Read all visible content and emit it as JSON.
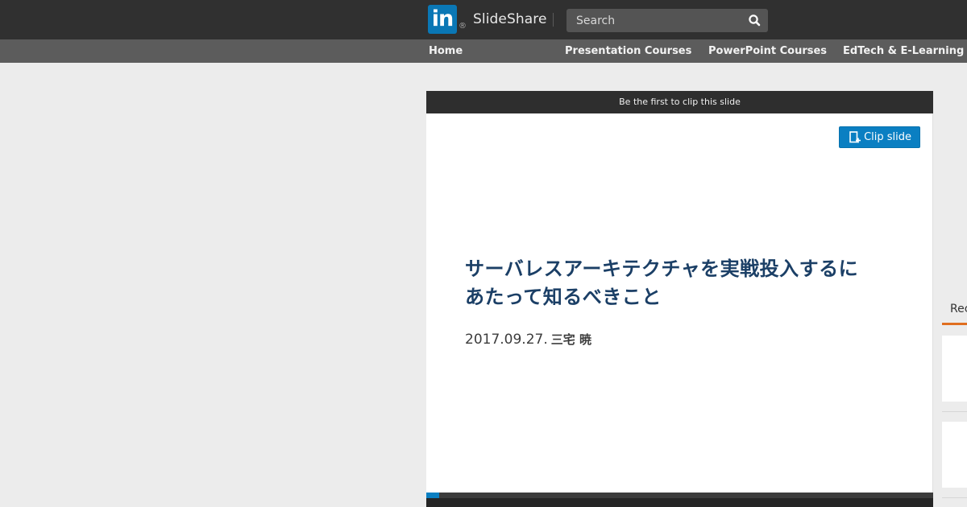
{
  "header": {
    "logo_mark": "in",
    "logo_registered": "®",
    "brand_name": "SlideShare",
    "search_placeholder": "Search",
    "search_icon": "search-icon"
  },
  "category_nav": {
    "items": [
      {
        "label": "Home"
      },
      {
        "label": "Presentation Courses"
      },
      {
        "label": "PowerPoint Courses"
      },
      {
        "label": "EdTech & E-Learning"
      }
    ]
  },
  "player": {
    "clip_bar_text": "Be the first to clip this slide",
    "clip_button_label": "Clip slide",
    "clip_icon": "clip-icon",
    "progress_fraction": 0.025
  },
  "slide": {
    "title_line1": "サーバレスアーキテクチャを実戦投入するに",
    "title_line2": "あたって知るべきこと",
    "date": "2017.09.27.",
    "author": "三宅 暁"
  },
  "sidebar": {
    "tab_label_visible": "Rec"
  },
  "colors": {
    "header_bg": "#303030",
    "nav_bg": "#5c5c5c",
    "accent_blue": "#0a7fc2",
    "linkedin_blue": "#0a77b5",
    "slide_title": "#1b3f66",
    "tab_underline": "#e06e1f",
    "page_bg": "#ececec"
  }
}
